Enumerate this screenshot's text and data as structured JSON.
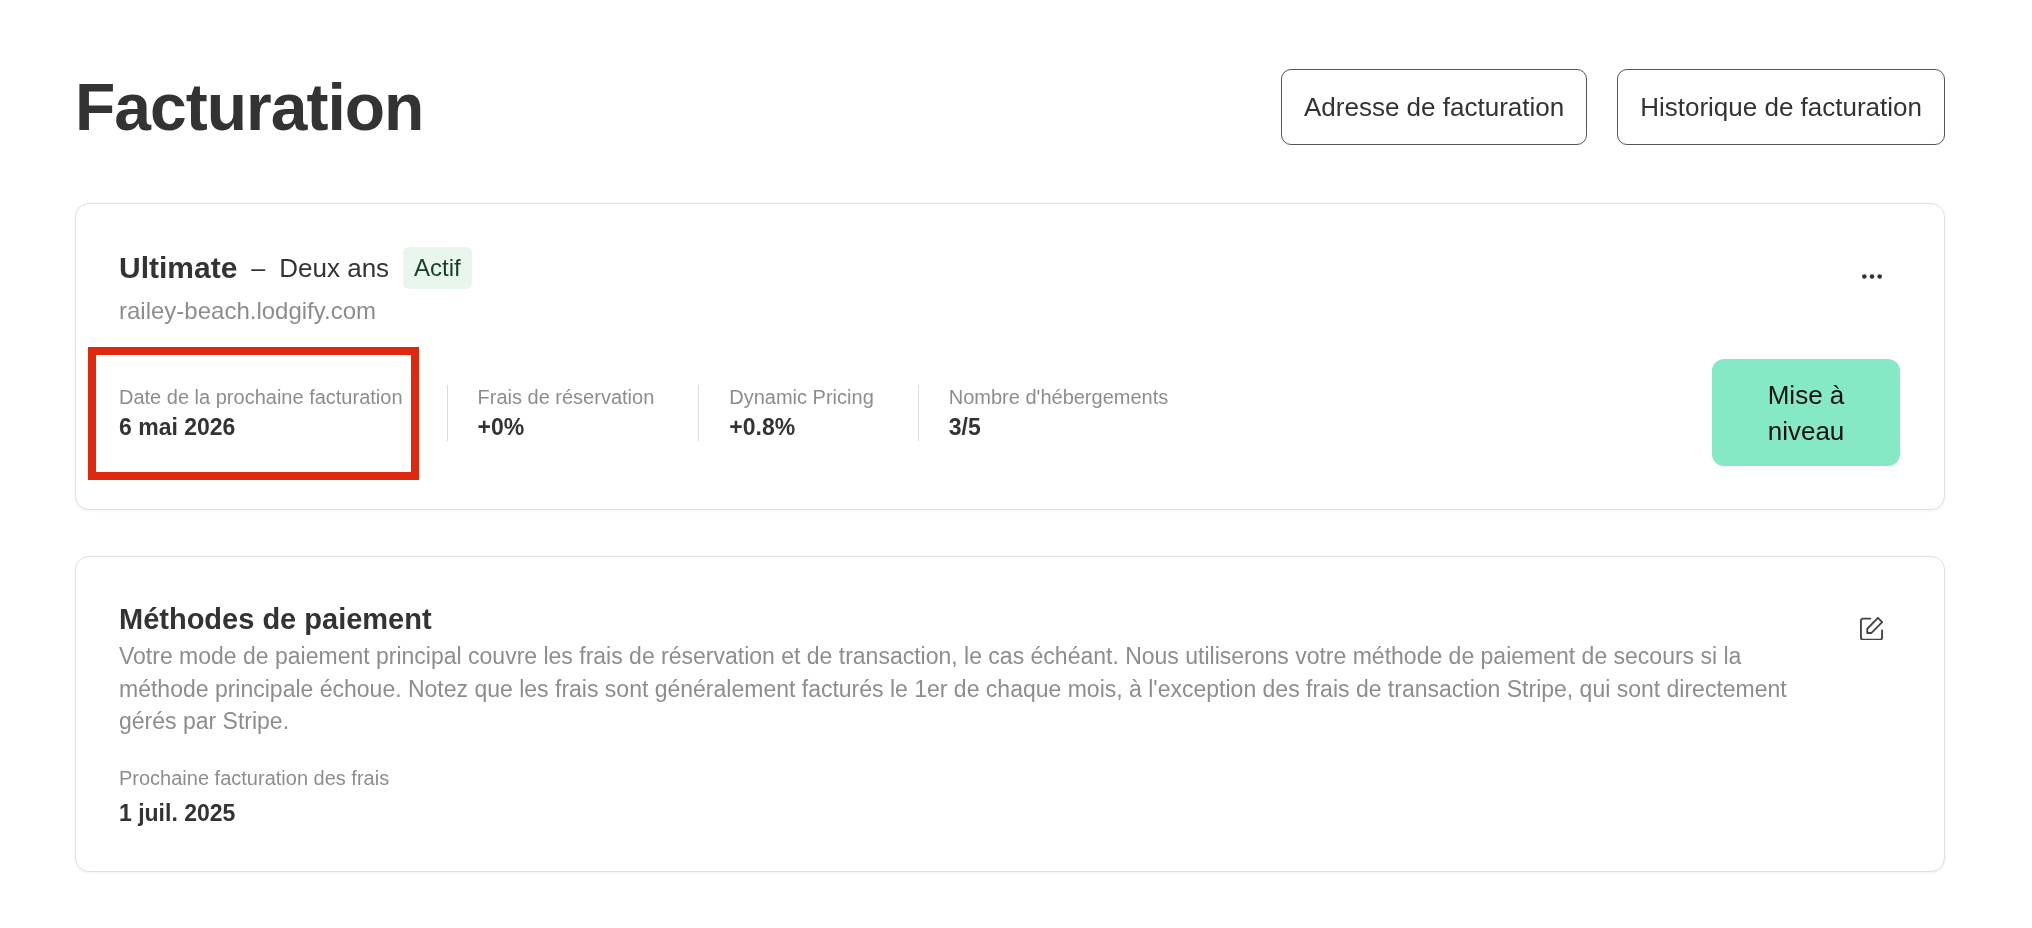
{
  "page": {
    "title": "Facturation"
  },
  "header_buttons": [
    {
      "label": "Adresse de facturation"
    },
    {
      "label": "Historique de facturation"
    }
  ],
  "plan_card": {
    "plan": "Ultimate",
    "separator": "–",
    "term": "Deux ans",
    "status": {
      "label": "Actif",
      "kind": "active"
    },
    "domain": "railey-beach.lodgify.com",
    "stats": [
      {
        "label": "Date de la prochaine facturation",
        "value": "6 mai 2026",
        "highlighted": true
      },
      {
        "label": "Frais de réservation",
        "value": "+0%",
        "highlighted": false
      },
      {
        "label": "Dynamic Pricing",
        "value": "+0.8%",
        "highlighted": false
      },
      {
        "label": "Nombre d'hébergements",
        "value": "3/5",
        "highlighted": false
      }
    ],
    "upgrade_button": "Mise à niveau"
  },
  "payment_card": {
    "title": "Méthodes de paiement",
    "description": "Votre mode de paiement principal couvre les frais de réservation et de transaction, le cas échéant. Nous utiliserons votre méthode de paiement de secours si la méthode principale échoue. Notez que les frais sont généralement facturés le 1er de chaque mois, à l'exception des frais de transaction Stripe, qui sont directement gérés par Stripe.",
    "next_billing": {
      "label": "Prochaine facturation des frais",
      "value": "1 juil. 2025"
    }
  }
}
